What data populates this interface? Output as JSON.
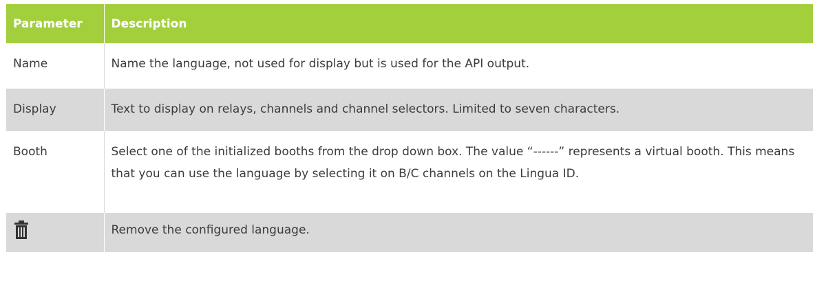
{
  "table": {
    "header": {
      "parameter": "Parameter",
      "description": "Description"
    },
    "rows": [
      {
        "parameter": "Name",
        "description": "Name the language, not used for display but is used for the API output."
      },
      {
        "parameter": "Display",
        "description": "Text to display on relays, channels and channel selectors. Limited to seven characters."
      },
      {
        "parameter": "Booth",
        "description": "Select one of the initialized booths from the drop down box. The value “------” represents a virtual booth. This means that you can use the language by selecting it on B/C channels on the Lingua ID."
      },
      {
        "parameter_icon": "trash-icon",
        "description": "Remove the configured language."
      }
    ]
  },
  "colors": {
    "header_bg": "#a3cf3d",
    "row_alt_bg": "#d9d9d9",
    "text": "#3c3c3c"
  }
}
